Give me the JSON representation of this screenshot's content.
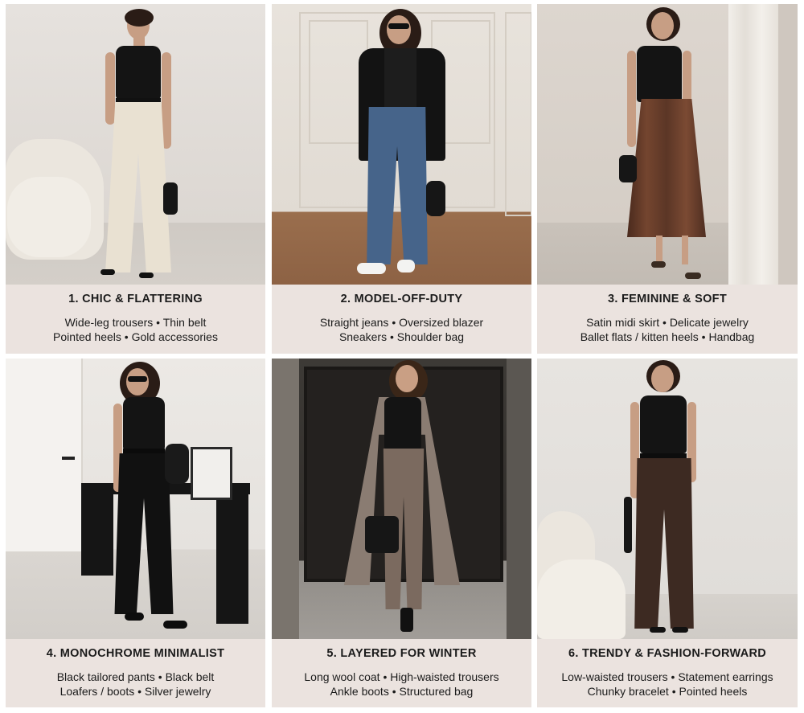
{
  "looks": [
    {
      "title": "1. CHIC & FLATTERING",
      "line1": "Wide-leg trousers • Thin belt",
      "line2": "Pointed heels • Gold accessories"
    },
    {
      "title": "2. MODEL-OFF-DUTY",
      "line1": "Straight jeans • Oversized blazer",
      "line2": "Sneakers • Shoulder bag"
    },
    {
      "title": "3. FEMININE & SOFT",
      "line1": "Satin midi skirt • Delicate jewelry",
      "line2": "Ballet flats / kitten heels • Handbag"
    },
    {
      "title": "4. MONOCHROME MINIMALIST",
      "line1": "Black tailored pants • Black belt",
      "line2": "Loafers / boots • Silver jewelry"
    },
    {
      "title": "5. LAYERED FOR WINTER",
      "line1": "Long wool coat • High-waisted trousers",
      "line2": "Ankle boots • Structured bag"
    },
    {
      "title": "6. TRENDY & FASHION-FORWARD",
      "line1": "Low-waisted trousers • Statement earrings",
      "line2": "Chunky bracelet • Pointed heels"
    }
  ],
  "colors": {
    "caption_bg": "#ebe3df",
    "text": "#1b1b1b",
    "top_black": "#141414",
    "cream_trouser": "#e9e1d2",
    "denim": "#46648a",
    "satin_brown": "#5b3626",
    "taupe_coat": "#8a7c72",
    "dark_brown": "#3d2a22"
  }
}
